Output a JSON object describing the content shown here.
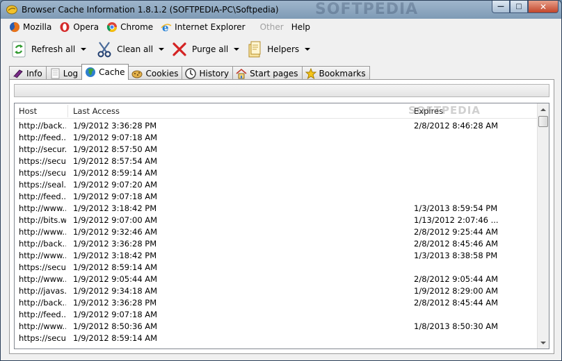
{
  "window": {
    "title": "Browser Cache Information 1.8.1.2 (SOFTPEDIA-PC\\Softpedia)",
    "watermark": "SOFTPEDIA"
  },
  "menu": {
    "items": [
      {
        "label": "Mozilla",
        "icon": "firefox-icon"
      },
      {
        "label": "Opera",
        "icon": "opera-icon"
      },
      {
        "label": "Chrome",
        "icon": "chrome-icon"
      },
      {
        "label": "Internet Explorer",
        "icon": "ie-icon"
      },
      {
        "label": "Other",
        "icon": ""
      },
      {
        "label": "Help",
        "icon": ""
      }
    ]
  },
  "toolbar": {
    "refresh_label": "Refresh all",
    "clean_label": "Clean all",
    "purge_label": "Purge all",
    "helpers_label": "Helpers"
  },
  "tabs": [
    {
      "label": "Info"
    },
    {
      "label": "Log"
    },
    {
      "label": "Cache"
    },
    {
      "label": "Cookies"
    },
    {
      "label": "History"
    },
    {
      "label": "Start pages"
    },
    {
      "label": "Bookmarks"
    }
  ],
  "table": {
    "columns": {
      "host": "Host",
      "last_access": "Last Access",
      "expires": "Expires"
    },
    "watermark": "SOFTPEDIA",
    "rows": [
      {
        "host": "http://back...",
        "last": "1/9/2012 3:36:28 PM",
        "exp": "2/8/2012 8:46:28 AM"
      },
      {
        "host": "http://feed...",
        "last": "1/9/2012 9:07:18 AM",
        "exp": ""
      },
      {
        "host": "http://secur...",
        "last": "1/9/2012 8:57:50 AM",
        "exp": ""
      },
      {
        "host": "https://secu...",
        "last": "1/9/2012 8:57:54 AM",
        "exp": ""
      },
      {
        "host": "https://secu...",
        "last": "1/9/2012 8:59:14 AM",
        "exp": ""
      },
      {
        "host": "https://seal...",
        "last": "1/9/2012 9:07:20 AM",
        "exp": ""
      },
      {
        "host": "http://feed...",
        "last": "1/9/2012 9:07:18 AM",
        "exp": ""
      },
      {
        "host": "http://www....",
        "last": "1/9/2012 3:18:42 PM",
        "exp": "1/3/2013 8:59:54 PM"
      },
      {
        "host": "http://bits.w...",
        "last": "1/9/2012 9:07:00 AM",
        "exp": "1/13/2012 2:07:46 ..."
      },
      {
        "host": "http://www....",
        "last": "1/9/2012 9:32:46 AM",
        "exp": "2/8/2012 9:25:44 AM"
      },
      {
        "host": "http://back...",
        "last": "1/9/2012 3:36:28 PM",
        "exp": "2/8/2012 8:45:46 AM"
      },
      {
        "host": "http://www....",
        "last": "1/9/2012 3:18:42 PM",
        "exp": "1/3/2013 8:38:58 PM"
      },
      {
        "host": "https://secu...",
        "last": "1/9/2012 8:59:14 AM",
        "exp": ""
      },
      {
        "host": "http://www....",
        "last": "1/9/2012 9:05:44 AM",
        "exp": "2/8/2012 9:05:44 AM"
      },
      {
        "host": "http://javas...",
        "last": "1/9/2012 9:34:18 AM",
        "exp": "1/9/2012 8:29:00 AM"
      },
      {
        "host": "http://back...",
        "last": "1/9/2012 3:36:28 PM",
        "exp": "2/8/2012 8:45:44 AM"
      },
      {
        "host": "http://feed...",
        "last": "1/9/2012 9:07:18 AM",
        "exp": ""
      },
      {
        "host": "http://www....",
        "last": "1/9/2012 8:50:36 AM",
        "exp": "1/8/2013 8:50:30 AM"
      },
      {
        "host": "https://secu...",
        "last": "1/9/2012 8:59:14 AM",
        "exp": ""
      }
    ]
  }
}
